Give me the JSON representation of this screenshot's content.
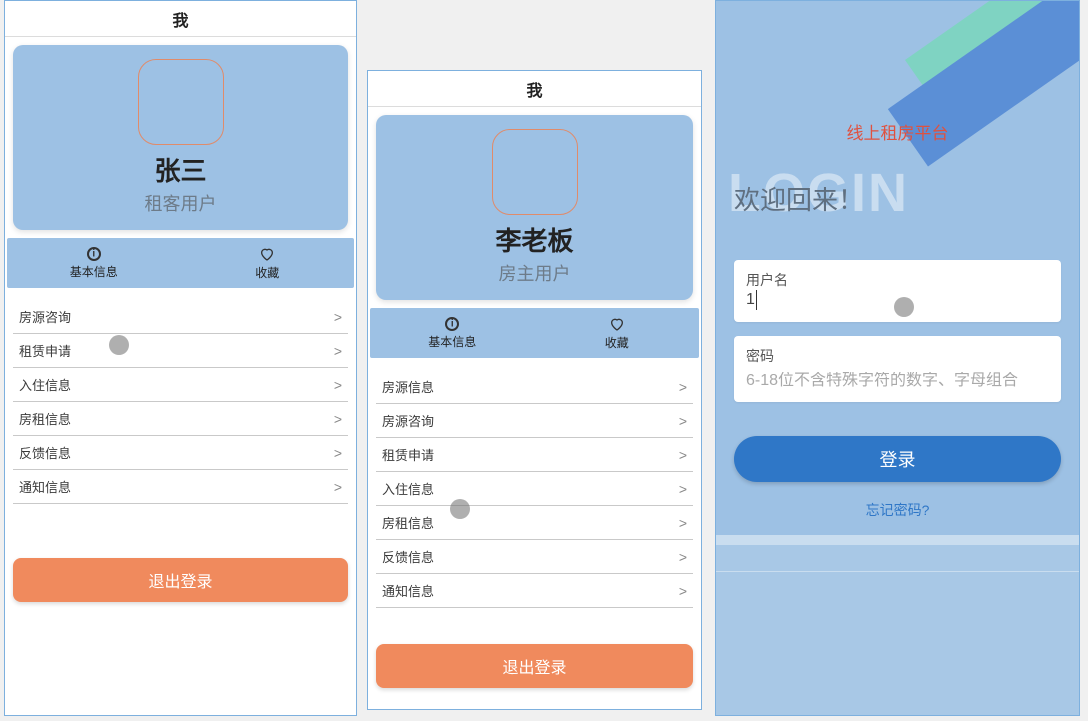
{
  "screenA": {
    "title": "我",
    "name": "张三",
    "role": "租客用户",
    "tabs": {
      "info": "基本信息",
      "fav": "收藏"
    },
    "items": [
      {
        "label": "房源咨询"
      },
      {
        "label": "租赁申请"
      },
      {
        "label": "入住信息"
      },
      {
        "label": "房租信息"
      },
      {
        "label": "反馈信息"
      },
      {
        "label": "通知信息"
      }
    ],
    "logout": "退出登录"
  },
  "screenB": {
    "title": "我",
    "name": "李老板",
    "role": "房主用户",
    "tabs": {
      "info": "基本信息",
      "fav": "收藏"
    },
    "items": [
      {
        "label": "房源信息"
      },
      {
        "label": "房源咨询"
      },
      {
        "label": "租赁申请"
      },
      {
        "label": "入住信息"
      },
      {
        "label": "房租信息"
      },
      {
        "label": "反馈信息"
      },
      {
        "label": "通知信息"
      }
    ],
    "logout": "退出登录"
  },
  "screenC": {
    "brand": "线上租房平台",
    "loginWord": "LOGIN",
    "welcome": "欢迎回来！",
    "username": {
      "label": "用户名",
      "value": "1"
    },
    "password": {
      "label": "密码",
      "placeholder": "6-18位不含特殊字符的数字、字母组合"
    },
    "loginBtn": "登录",
    "forgot": "忘记密码?"
  }
}
